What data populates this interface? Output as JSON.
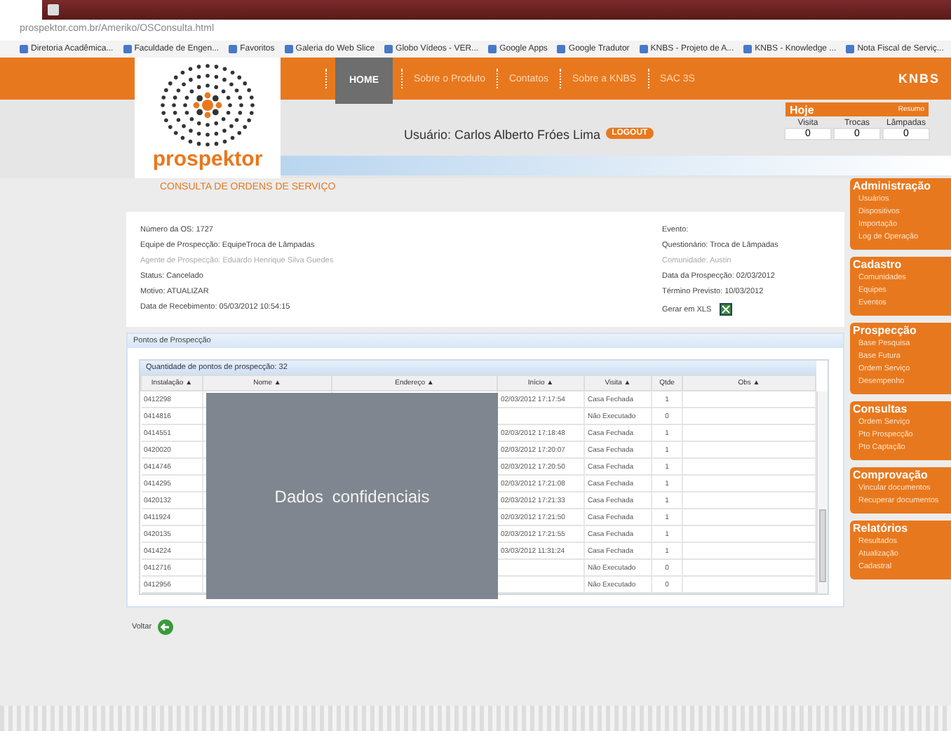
{
  "browser": {
    "url": "prospektor.com.br/Ameriko/OSConsulta.html",
    "bookmarks": [
      {
        "label": "Diretoria Acadêmica..."
      },
      {
        "label": "Faculdade de Engen..."
      },
      {
        "label": "Favoritos"
      },
      {
        "label": "Galeria do Web Slice"
      },
      {
        "label": "Globo Vídeos - VER..."
      },
      {
        "label": "Google Apps"
      },
      {
        "label": "Google Tradutor"
      },
      {
        "label": "KNBS - Projeto de A..."
      },
      {
        "label": "KNBS - Knowledge ..."
      },
      {
        "label": "Nota Fiscal de Serviç..."
      }
    ]
  },
  "header": {
    "logo": "prospektor",
    "brand": "KNBS",
    "nav": [
      {
        "label": "HOME",
        "selected": true
      },
      {
        "label": "Sobre o Produto",
        "selected": false
      },
      {
        "label": "Contatos",
        "selected": false
      },
      {
        "label": "Sobre a KNBS",
        "selected": false
      },
      {
        "label": "SAC 3S",
        "selected": false
      }
    ],
    "user": "Usuário: Carlos Alberto Fróes Lima",
    "logout": "LOGOUT",
    "today": {
      "title": "Hoje",
      "link": "Resumo",
      "stats": [
        {
          "label": "Visita",
          "value": "0"
        },
        {
          "label": "Trocas",
          "value": "0"
        },
        {
          "label": "Lâmpadas",
          "value": "0"
        }
      ]
    }
  },
  "page_title": "CONSULTA DE ORDENS DE SERVIÇO",
  "details": {
    "left": [
      {
        "text": "Número da OS: 1727",
        "disabled": false
      },
      {
        "text": "Equipe de Prospecção: EquipeTroca de Lâmpadas",
        "disabled": false
      },
      {
        "text": "Agente de Prospecção: Eduardo Henrique Silva Guedes",
        "disabled": true
      },
      {
        "text": "Status: Cancelado",
        "disabled": false
      },
      {
        "text": "Motivo: ATUALIZAR",
        "disabled": false
      },
      {
        "text": "Data de Recebimento: 05/03/2012 10:54:15",
        "disabled": false
      }
    ],
    "right": [
      {
        "text": "Evento:",
        "disabled": false
      },
      {
        "text": "Questionário: Troca de Lâmpadas",
        "disabled": false
      },
      {
        "text": "Comunidade: Austin",
        "disabled": true
      },
      {
        "text": "Data da Prospecção: 02/03/2012",
        "disabled": false
      },
      {
        "text": "Término Previsto: 10/03/2012",
        "disabled": false
      }
    ],
    "export": "Gerar em XLS"
  },
  "section_title": "Pontos de Prospecção",
  "table": {
    "count": "Quantidade de pontos de prospecção: 32",
    "columns": [
      "Instalação ▲",
      "Nome ▲",
      "Endereço ▲",
      "Início ▲",
      "Visita ▲",
      "Qtde",
      "Obs ▲"
    ],
    "rows": [
      [
        "0412298",
        "",
        "",
        "02/03/2012 17:17:54",
        "Casa Fechada",
        "1",
        ""
      ],
      [
        "0414816",
        "",
        "",
        "",
        "Não Executado",
        "0",
        ""
      ],
      [
        "0414551",
        "",
        "",
        "02/03/2012 17:18:48",
        "Casa Fechada",
        "1",
        ""
      ],
      [
        "0420020",
        "",
        "",
        "02/03/2012 17:20:07",
        "Casa Fechada",
        "1",
        ""
      ],
      [
        "0414746",
        "",
        "",
        "02/03/2012 17:20:50",
        "Casa Fechada",
        "1",
        ""
      ],
      [
        "0414295",
        "",
        "",
        "02/03/2012 17:21:08",
        "Casa Fechada",
        "1",
        ""
      ],
      [
        "0420132",
        "",
        "",
        "02/03/2012 17:21:33",
        "Casa Fechada",
        "1",
        ""
      ],
      [
        "0411924",
        "",
        "",
        "02/03/2012 17:21:50",
        "Casa Fechada",
        "1",
        ""
      ],
      [
        "0420135",
        "",
        "",
        "02/03/2012 17:21:55",
        "Casa Fechada",
        "1",
        ""
      ],
      [
        "0414224",
        "",
        "",
        "03/03/2012 11:31:24",
        "Casa Fechada",
        "1",
        ""
      ],
      [
        "0412716",
        "",
        "",
        "",
        "Não Executado",
        "0",
        ""
      ],
      [
        "0412956",
        "",
        "",
        "",
        "Não Executado",
        "0",
        ""
      ]
    ],
    "overlay": "Dados confidenciais"
  },
  "back": "Voltar",
  "sidebar": [
    {
      "title": "Administração",
      "items": [
        "Usuários",
        "Dispositivos",
        "Importação",
        "Log de Operação"
      ]
    },
    {
      "title": "Cadastro",
      "items": [
        "Comunidades",
        "Equipes",
        "Eventos"
      ]
    },
    {
      "title": "Prospecção",
      "items": [
        "Base Pesquisa",
        "Base Futura",
        "Ordem Serviço",
        "Desempenho"
      ]
    },
    {
      "title": "Consultas",
      "items": [
        "Ordem Serviço",
        "Pto Prospecção",
        "Pto Captação"
      ]
    },
    {
      "title": "Comprovação",
      "items": [
        "Vincular documentos",
        "Recuperar documentos"
      ]
    },
    {
      "title": "Relatórios",
      "items": [
        "Resultados",
        "Atualização",
        "Cadastral"
      ]
    }
  ]
}
